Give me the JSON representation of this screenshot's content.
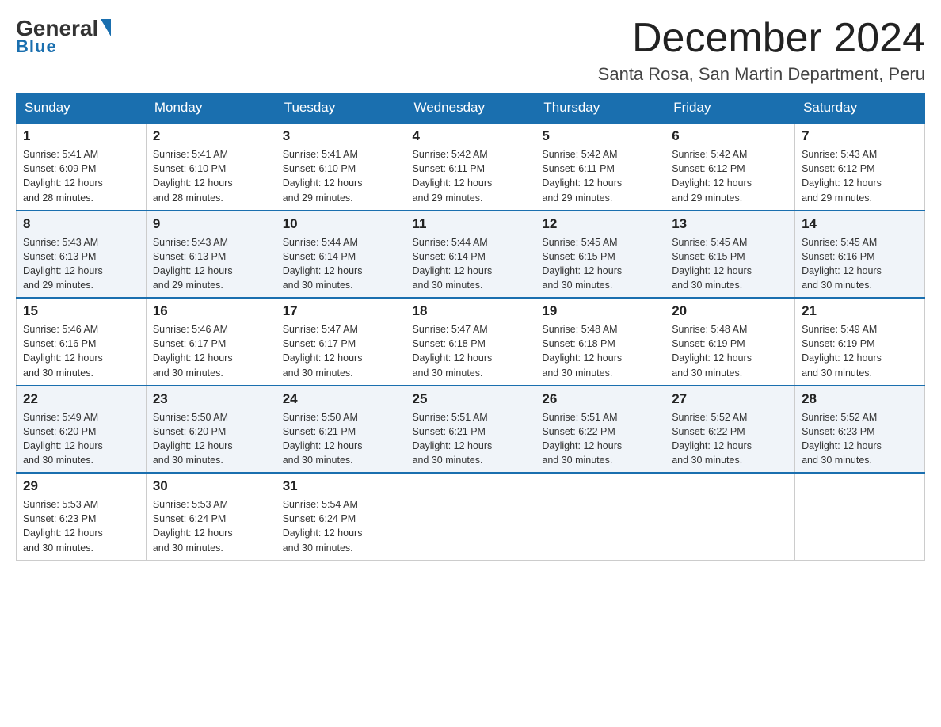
{
  "header": {
    "logo_general": "General",
    "logo_blue": "Blue",
    "month_title": "December 2024",
    "location": "Santa Rosa, San Martin Department, Peru"
  },
  "days_of_week": [
    "Sunday",
    "Monday",
    "Tuesday",
    "Wednesday",
    "Thursday",
    "Friday",
    "Saturday"
  ],
  "weeks": [
    [
      {
        "day": "1",
        "sunrise": "5:41 AM",
        "sunset": "6:09 PM",
        "daylight": "12 hours and 28 minutes."
      },
      {
        "day": "2",
        "sunrise": "5:41 AM",
        "sunset": "6:10 PM",
        "daylight": "12 hours and 28 minutes."
      },
      {
        "day": "3",
        "sunrise": "5:41 AM",
        "sunset": "6:10 PM",
        "daylight": "12 hours and 29 minutes."
      },
      {
        "day": "4",
        "sunrise": "5:42 AM",
        "sunset": "6:11 PM",
        "daylight": "12 hours and 29 minutes."
      },
      {
        "day": "5",
        "sunrise": "5:42 AM",
        "sunset": "6:11 PM",
        "daylight": "12 hours and 29 minutes."
      },
      {
        "day": "6",
        "sunrise": "5:42 AM",
        "sunset": "6:12 PM",
        "daylight": "12 hours and 29 minutes."
      },
      {
        "day": "7",
        "sunrise": "5:43 AM",
        "sunset": "6:12 PM",
        "daylight": "12 hours and 29 minutes."
      }
    ],
    [
      {
        "day": "8",
        "sunrise": "5:43 AM",
        "sunset": "6:13 PM",
        "daylight": "12 hours and 29 minutes."
      },
      {
        "day": "9",
        "sunrise": "5:43 AM",
        "sunset": "6:13 PM",
        "daylight": "12 hours and 29 minutes."
      },
      {
        "day": "10",
        "sunrise": "5:44 AM",
        "sunset": "6:14 PM",
        "daylight": "12 hours and 30 minutes."
      },
      {
        "day": "11",
        "sunrise": "5:44 AM",
        "sunset": "6:14 PM",
        "daylight": "12 hours and 30 minutes."
      },
      {
        "day": "12",
        "sunrise": "5:45 AM",
        "sunset": "6:15 PM",
        "daylight": "12 hours and 30 minutes."
      },
      {
        "day": "13",
        "sunrise": "5:45 AM",
        "sunset": "6:15 PM",
        "daylight": "12 hours and 30 minutes."
      },
      {
        "day": "14",
        "sunrise": "5:45 AM",
        "sunset": "6:16 PM",
        "daylight": "12 hours and 30 minutes."
      }
    ],
    [
      {
        "day": "15",
        "sunrise": "5:46 AM",
        "sunset": "6:16 PM",
        "daylight": "12 hours and 30 minutes."
      },
      {
        "day": "16",
        "sunrise": "5:46 AM",
        "sunset": "6:17 PM",
        "daylight": "12 hours and 30 minutes."
      },
      {
        "day": "17",
        "sunrise": "5:47 AM",
        "sunset": "6:17 PM",
        "daylight": "12 hours and 30 minutes."
      },
      {
        "day": "18",
        "sunrise": "5:47 AM",
        "sunset": "6:18 PM",
        "daylight": "12 hours and 30 minutes."
      },
      {
        "day": "19",
        "sunrise": "5:48 AM",
        "sunset": "6:18 PM",
        "daylight": "12 hours and 30 minutes."
      },
      {
        "day": "20",
        "sunrise": "5:48 AM",
        "sunset": "6:19 PM",
        "daylight": "12 hours and 30 minutes."
      },
      {
        "day": "21",
        "sunrise": "5:49 AM",
        "sunset": "6:19 PM",
        "daylight": "12 hours and 30 minutes."
      }
    ],
    [
      {
        "day": "22",
        "sunrise": "5:49 AM",
        "sunset": "6:20 PM",
        "daylight": "12 hours and 30 minutes."
      },
      {
        "day": "23",
        "sunrise": "5:50 AM",
        "sunset": "6:20 PM",
        "daylight": "12 hours and 30 minutes."
      },
      {
        "day": "24",
        "sunrise": "5:50 AM",
        "sunset": "6:21 PM",
        "daylight": "12 hours and 30 minutes."
      },
      {
        "day": "25",
        "sunrise": "5:51 AM",
        "sunset": "6:21 PM",
        "daylight": "12 hours and 30 minutes."
      },
      {
        "day": "26",
        "sunrise": "5:51 AM",
        "sunset": "6:22 PM",
        "daylight": "12 hours and 30 minutes."
      },
      {
        "day": "27",
        "sunrise": "5:52 AM",
        "sunset": "6:22 PM",
        "daylight": "12 hours and 30 minutes."
      },
      {
        "day": "28",
        "sunrise": "5:52 AM",
        "sunset": "6:23 PM",
        "daylight": "12 hours and 30 minutes."
      }
    ],
    [
      {
        "day": "29",
        "sunrise": "5:53 AM",
        "sunset": "6:23 PM",
        "daylight": "12 hours and 30 minutes."
      },
      {
        "day": "30",
        "sunrise": "5:53 AM",
        "sunset": "6:24 PM",
        "daylight": "12 hours and 30 minutes."
      },
      {
        "day": "31",
        "sunrise": "5:54 AM",
        "sunset": "6:24 PM",
        "daylight": "12 hours and 30 minutes."
      },
      null,
      null,
      null,
      null
    ]
  ],
  "labels": {
    "sunrise": "Sunrise:",
    "sunset": "Sunset:",
    "daylight": "Daylight:"
  }
}
